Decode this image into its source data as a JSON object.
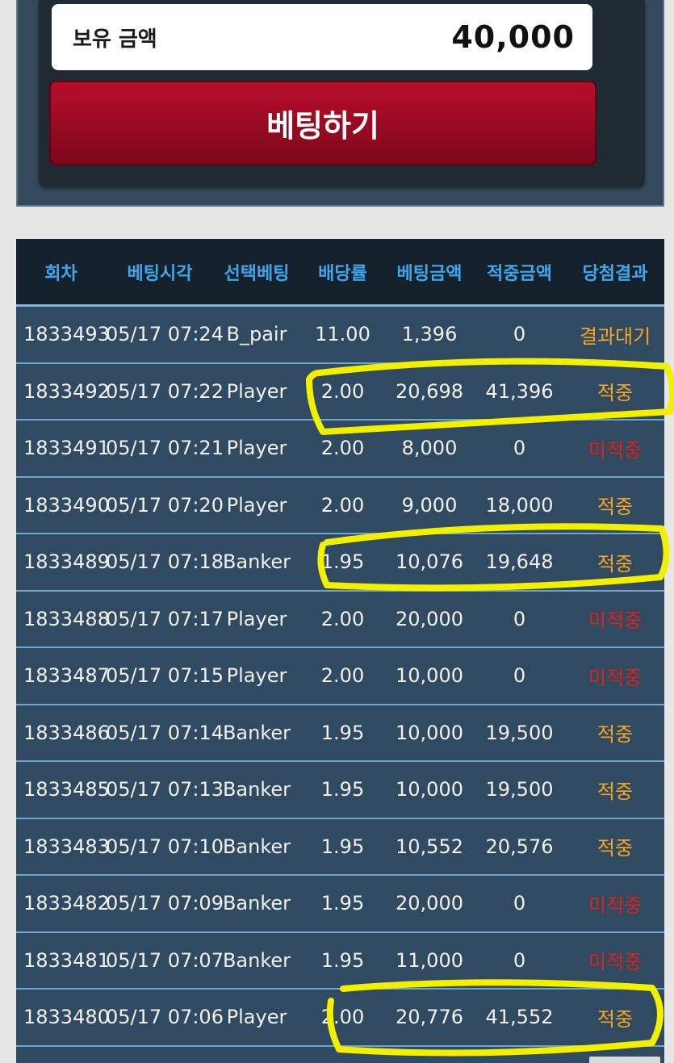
{
  "balance": {
    "label": "보유 금액",
    "value": "40,000"
  },
  "bet_button": {
    "label": "베팅하기"
  },
  "table": {
    "headers": [
      "회차",
      "베팅시각",
      "선택베팅",
      "배당률",
      "베팅금액",
      "적중금액",
      "당첨결과"
    ],
    "rows": [
      {
        "round": "1833493",
        "time": "05/17 07:24",
        "pick": "B_pair",
        "odds": "11.00",
        "bet": "1,396",
        "win": "0",
        "result": "결과대기",
        "status": "wait"
      },
      {
        "round": "1833492",
        "time": "05/17 07:22",
        "pick": "Player",
        "odds": "2.00",
        "bet": "20,698",
        "win": "41,396",
        "result": "적중",
        "status": "hit"
      },
      {
        "round": "1833491",
        "time": "05/17 07:21",
        "pick": "Player",
        "odds": "2.00",
        "bet": "8,000",
        "win": "0",
        "result": "미적중",
        "status": "miss"
      },
      {
        "round": "1833490",
        "time": "05/17 07:20",
        "pick": "Player",
        "odds": "2.00",
        "bet": "9,000",
        "win": "18,000",
        "result": "적중",
        "status": "hit"
      },
      {
        "round": "1833489",
        "time": "05/17 07:18",
        "pick": "Banker",
        "odds": "1.95",
        "bet": "10,076",
        "win": "19,648",
        "result": "적중",
        "status": "hit"
      },
      {
        "round": "1833488",
        "time": "05/17 07:17",
        "pick": "Player",
        "odds": "2.00",
        "bet": "20,000",
        "win": "0",
        "result": "미적중",
        "status": "miss"
      },
      {
        "round": "1833487",
        "time": "05/17 07:15",
        "pick": "Player",
        "odds": "2.00",
        "bet": "10,000",
        "win": "0",
        "result": "미적중",
        "status": "miss"
      },
      {
        "round": "1833486",
        "time": "05/17 07:14",
        "pick": "Banker",
        "odds": "1.95",
        "bet": "10,000",
        "win": "19,500",
        "result": "적중",
        "status": "hit"
      },
      {
        "round": "1833485",
        "time": "05/17 07:13",
        "pick": "Banker",
        "odds": "1.95",
        "bet": "10,000",
        "win": "19,500",
        "result": "적중",
        "status": "hit"
      },
      {
        "round": "1833483",
        "time": "05/17 07:10",
        "pick": "Banker",
        "odds": "1.95",
        "bet": "10,552",
        "win": "20,576",
        "result": "적중",
        "status": "hit"
      },
      {
        "round": "1833482",
        "time": "05/17 07:09",
        "pick": "Banker",
        "odds": "1.95",
        "bet": "20,000",
        "win": "0",
        "result": "미적중",
        "status": "miss"
      },
      {
        "round": "1833481",
        "time": "05/17 07:07",
        "pick": "Banker",
        "odds": "1.95",
        "bet": "11,000",
        "win": "0",
        "result": "미적중",
        "status": "miss"
      },
      {
        "round": "1833480",
        "time": "05/17 07:06",
        "pick": "Player",
        "odds": "2.00",
        "bet": "20,776",
        "win": "41,552",
        "result": "적중",
        "status": "hit"
      }
    ]
  },
  "colors": {
    "hit": "#f5a623",
    "miss": "#d9231c",
    "wait": "#f5a623",
    "highlight": "#f2ef00"
  }
}
